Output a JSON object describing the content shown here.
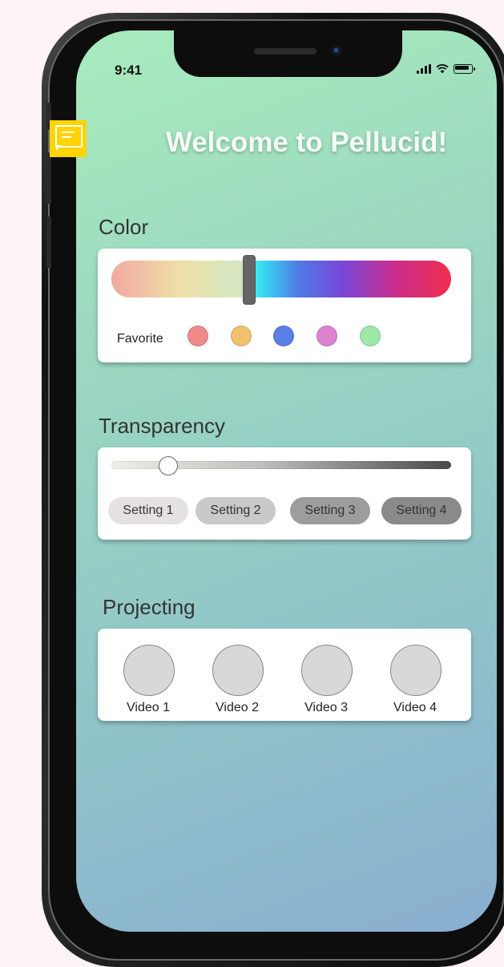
{
  "status_bar": {
    "time": "9:41"
  },
  "header": {
    "title": "Welcome to Pellucid!"
  },
  "color": {
    "label": "Color",
    "hue_slider_value": 0.41,
    "favorite_label": "Favorite",
    "favorites": [
      {
        "name": "red",
        "color": "#f08a8a"
      },
      {
        "name": "orange",
        "color": "#f0c26e"
      },
      {
        "name": "blue",
        "color": "#5a7fe6"
      },
      {
        "name": "magenta",
        "color": "#dc84cf"
      },
      {
        "name": "green",
        "color": "#9ee8a8"
      }
    ]
  },
  "transparency": {
    "label": "Transparency",
    "slider_value": 0.17,
    "settings": [
      {
        "label": "Setting 1",
        "bg": "#e6e1e1"
      },
      {
        "label": "Setting 2",
        "bg": "#cbc8c8"
      },
      {
        "label": "Setting 3",
        "bg": "#9d9d9d"
      },
      {
        "label": "Setting 4",
        "bg": "#8a8a8a"
      }
    ]
  },
  "projecting": {
    "label": "Projecting",
    "videos": [
      {
        "label": "Video 1"
      },
      {
        "label": "Video 2"
      },
      {
        "label": "Video 3"
      },
      {
        "label": "Video 4"
      }
    ]
  },
  "icons": [
    "comment-icon",
    "signal-icon",
    "wifi-icon",
    "battery-icon"
  ]
}
